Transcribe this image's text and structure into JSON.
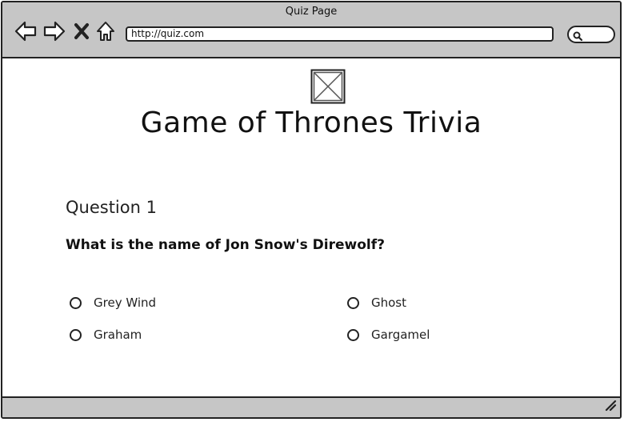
{
  "window": {
    "title": "Quiz Page",
    "url": "http://quiz.com",
    "nav_icons": [
      "back-arrow-icon",
      "forward-arrow-icon",
      "close-icon",
      "home-icon"
    ],
    "search_icon": "search-icon"
  },
  "page": {
    "title": "Game of Thrones Trivia",
    "image": "image-placeholder-icon"
  },
  "question": {
    "heading": "Question 1",
    "text": "What is the name of Jon Snow's Direwolf?",
    "options": [
      "Grey Wind",
      "Ghost",
      "Graham",
      "Gargamel"
    ]
  },
  "colors": {
    "chrome": "#c6c6c6",
    "border": "#222222",
    "background": "#ffffff"
  }
}
